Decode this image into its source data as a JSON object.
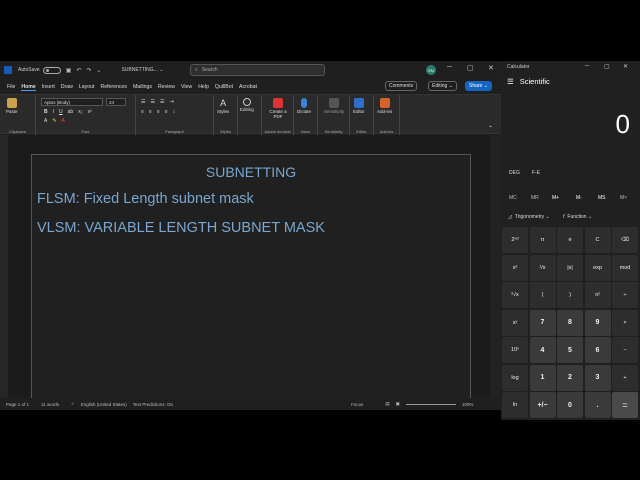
{
  "word": {
    "autosave_label": "AutoSave",
    "doc_title": "SUBNETTING... ⌄",
    "search_placeholder": "Search",
    "user_initials": "EN",
    "menu": [
      "File",
      "Home",
      "Insert",
      "Draw",
      "Layout",
      "References",
      "Mailings",
      "Review",
      "View",
      "Help",
      "QuillBot",
      "Acrobat"
    ],
    "comments_label": "Comments",
    "editing_label": "Editing ⌄",
    "share_label": "Share ⌄",
    "font_name": "Aptos (Body)",
    "font_size": "24",
    "ribbon": {
      "paste": "Paste",
      "clipboard": "Clipboard",
      "font": "Font",
      "paragraph": "Paragraph",
      "styles": "Styles",
      "styles_group": "Styles",
      "editing": "Editing",
      "create_pdf": "Create a PDF",
      "adobe": "Adobe Acrobat",
      "dictate": "Dictate",
      "voice": "Voice",
      "sensitivity": "Sensitivity",
      "sensitivity_group": "Sensitivity",
      "editor": "Editor",
      "editor_group": "Editor",
      "addins": "Add-ins",
      "addins_group": "Add-ins"
    },
    "document": {
      "heading": "SUBNETTING",
      "line1": "FLSM: Fixed Length subnet mask",
      "line2": "VLSM: VARIABLE LENGTH SUBNET MASK"
    },
    "status": {
      "page": "Page 1 of 1",
      "words": "11 words",
      "language": "English (United States)",
      "predictions": "Text Predictions: On",
      "focus": "Focus",
      "zoom": "100%"
    }
  },
  "calculator": {
    "title": "Calculator",
    "mode": "Scientific",
    "display": "0",
    "deg": "DEG",
    "fe": "F-E",
    "memory": [
      "MC",
      "MR",
      "M+",
      "M-",
      "MS",
      "M˅"
    ],
    "trig": "Trigonometry ⌄",
    "function": "Function ⌄",
    "keys": [
      [
        "2ⁿᵈ",
        "π",
        "e",
        "C",
        "⌫"
      ],
      [
        "x²",
        "¹/x",
        "|x|",
        "exp",
        "mod"
      ],
      [
        "²√x",
        "(",
        ")",
        "n!",
        "÷"
      ],
      [
        "xʸ",
        "7",
        "8",
        "9",
        "×"
      ],
      [
        "10ˣ",
        "4",
        "5",
        "6",
        "−"
      ],
      [
        "log",
        "1",
        "2",
        "3",
        "+"
      ],
      [
        "ln",
        "+/−",
        "0",
        ".",
        "="
      ]
    ]
  }
}
